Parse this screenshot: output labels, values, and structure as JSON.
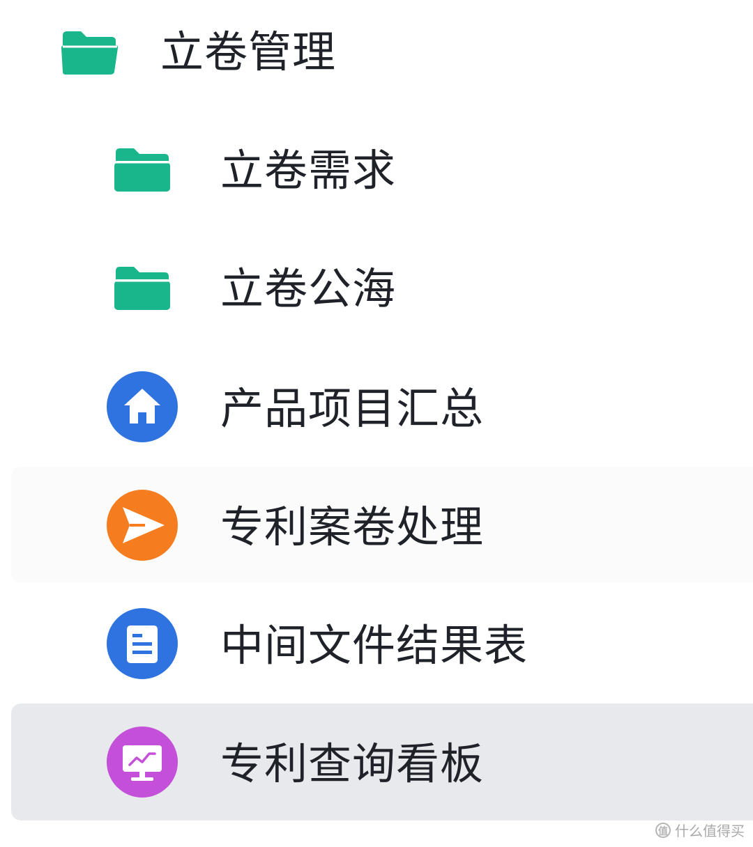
{
  "nav": {
    "colors": {
      "folder": "#19b58b",
      "home": "#2f73e0",
      "send": "#f57c1f",
      "doc": "#2f73e0",
      "dashboard": "#c44fd9",
      "selected_bg": "#e8e9ec",
      "text": "#1f2329"
    },
    "root": {
      "label": "立卷管理",
      "icon": "folder-open-icon"
    },
    "items": [
      {
        "label": "立卷需求",
        "icon": "folder-icon"
      },
      {
        "label": "立卷公海",
        "icon": "folder-icon"
      },
      {
        "label": "产品项目汇总",
        "icon": "home-icon"
      },
      {
        "label": "专利案卷处理",
        "icon": "send-icon"
      },
      {
        "label": "中间文件结果表",
        "icon": "document-icon"
      },
      {
        "label": "专利查询看板",
        "icon": "dashboard-icon",
        "selected": true
      }
    ]
  },
  "watermark": {
    "text": "什么值得买",
    "badge": "值"
  }
}
